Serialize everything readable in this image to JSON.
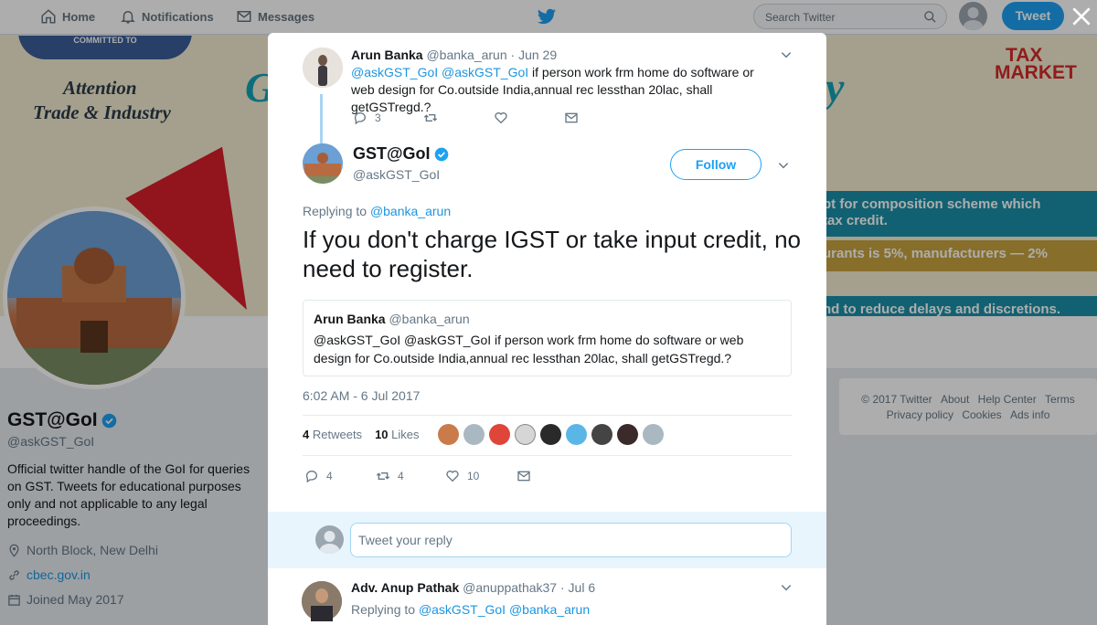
{
  "nav": {
    "home": "Home",
    "notifications": "Notifications",
    "messages": "Messages",
    "search_placeholder": "Search Twitter",
    "tweet_button": "Tweet"
  },
  "banner": {
    "left_line1": "Attention",
    "left_line2": "Trade & Industry",
    "stripe1a": "pt for composition scheme which",
    "stripe1b": "tax credit.",
    "stripe2": "urants is 5%, manufacturers — 2%",
    "stripe3": "nd to reduce delays and discretions.",
    "logo_line1": "TAX",
    "logo_line2": "MARKET",
    "ribbon": "COMMITTED TO"
  },
  "profile": {
    "name": "GST@GoI",
    "handle": "@askGST_GoI",
    "bio": "Official twitter handle of the GoI for queries on GST. Tweets for educational purposes only and not applicable to any legal proceedings.",
    "location": "North Block, New Delhi",
    "website": "cbec.gov.in",
    "joined": "Joined May 2017"
  },
  "footer": {
    "line1": [
      "© 2017 Twitter",
      "About",
      "Help Center",
      "Terms"
    ],
    "line2": [
      "Privacy policy",
      "Cookies",
      "Ads info"
    ]
  },
  "parent_tweet": {
    "name": "Arun Banka",
    "handle": "@banka_arun",
    "date": "· Jun 29",
    "mentions": "@askGST_GoI @askGST_GoI",
    "text": " if person work frm home do software or web design for Co.outside India,annual rec lessthan 20lac, shall getGSTregd.?",
    "reply_count": "3"
  },
  "main_tweet": {
    "name": "GST@GoI",
    "handle": "@askGST_GoI",
    "follow_label": "Follow",
    "replying_prefix": "Replying to",
    "replying_to": "@banka_arun",
    "text": "If you don't charge IGST or take input credit, no need to register.",
    "quote": {
      "name": "Arun Banka",
      "handle": "@banka_arun",
      "text": "@askGST_GoI @askGST_GoI if person work frm home do software or web design for Co.outside India,annual rec lessthan 20lac, shall getGSTregd.?"
    },
    "timestamp": "6:02 AM - 6 Jul 2017",
    "retweets_count": "4",
    "retweets_label": "Retweets",
    "likes_count": "10",
    "likes_label": "Likes",
    "reply_count": "4",
    "retweet_count_action": "4",
    "like_count_action": "10"
  },
  "reply_box": {
    "placeholder": "Tweet your reply"
  },
  "next_reply": {
    "name": "Adv. Anup Pathak",
    "handle": "@anuppathak37",
    "date": "· Jul 6",
    "replying_prefix": "Replying to",
    "replying_to": "@askGST_GoI @banka_arun"
  },
  "colors": {
    "accent": "#1da1f2",
    "link": "#1b95e0",
    "muted": "#657786"
  }
}
